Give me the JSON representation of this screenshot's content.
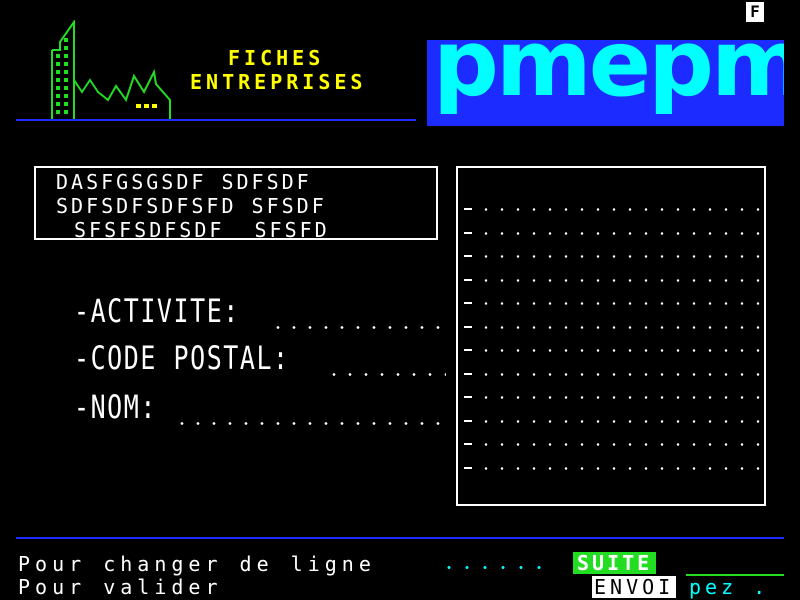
{
  "header": {
    "badge": "F",
    "title_line1": "FICHES",
    "title_line2": "ENTREPRISES",
    "logo_text": "pmepmi"
  },
  "address": {
    "line1": "DASFGSGSDF SDFSDF",
    "line2": "SDFSDFSDFSFD SFSDF",
    "line3": "SFSFSDFSDF  SFSFD"
  },
  "form": {
    "activite_label": "-ACTIVITE:",
    "code_postal_label": "-CODE POSTAL:",
    "nom_label": "-NOM:"
  },
  "list": {
    "row_count": 12
  },
  "footer": {
    "line1": "Pour changer de ligne",
    "line2": "Pour valider",
    "key_suite": "SUITE",
    "key_envoi": "ENVOI",
    "pez": "pez ."
  },
  "colors": {
    "background": "#000000",
    "rule_blue": "#1c2bff",
    "logo_cyan": "#00ffff",
    "title_yellow": "#ffff00",
    "skyline_green": "#22dd22"
  }
}
